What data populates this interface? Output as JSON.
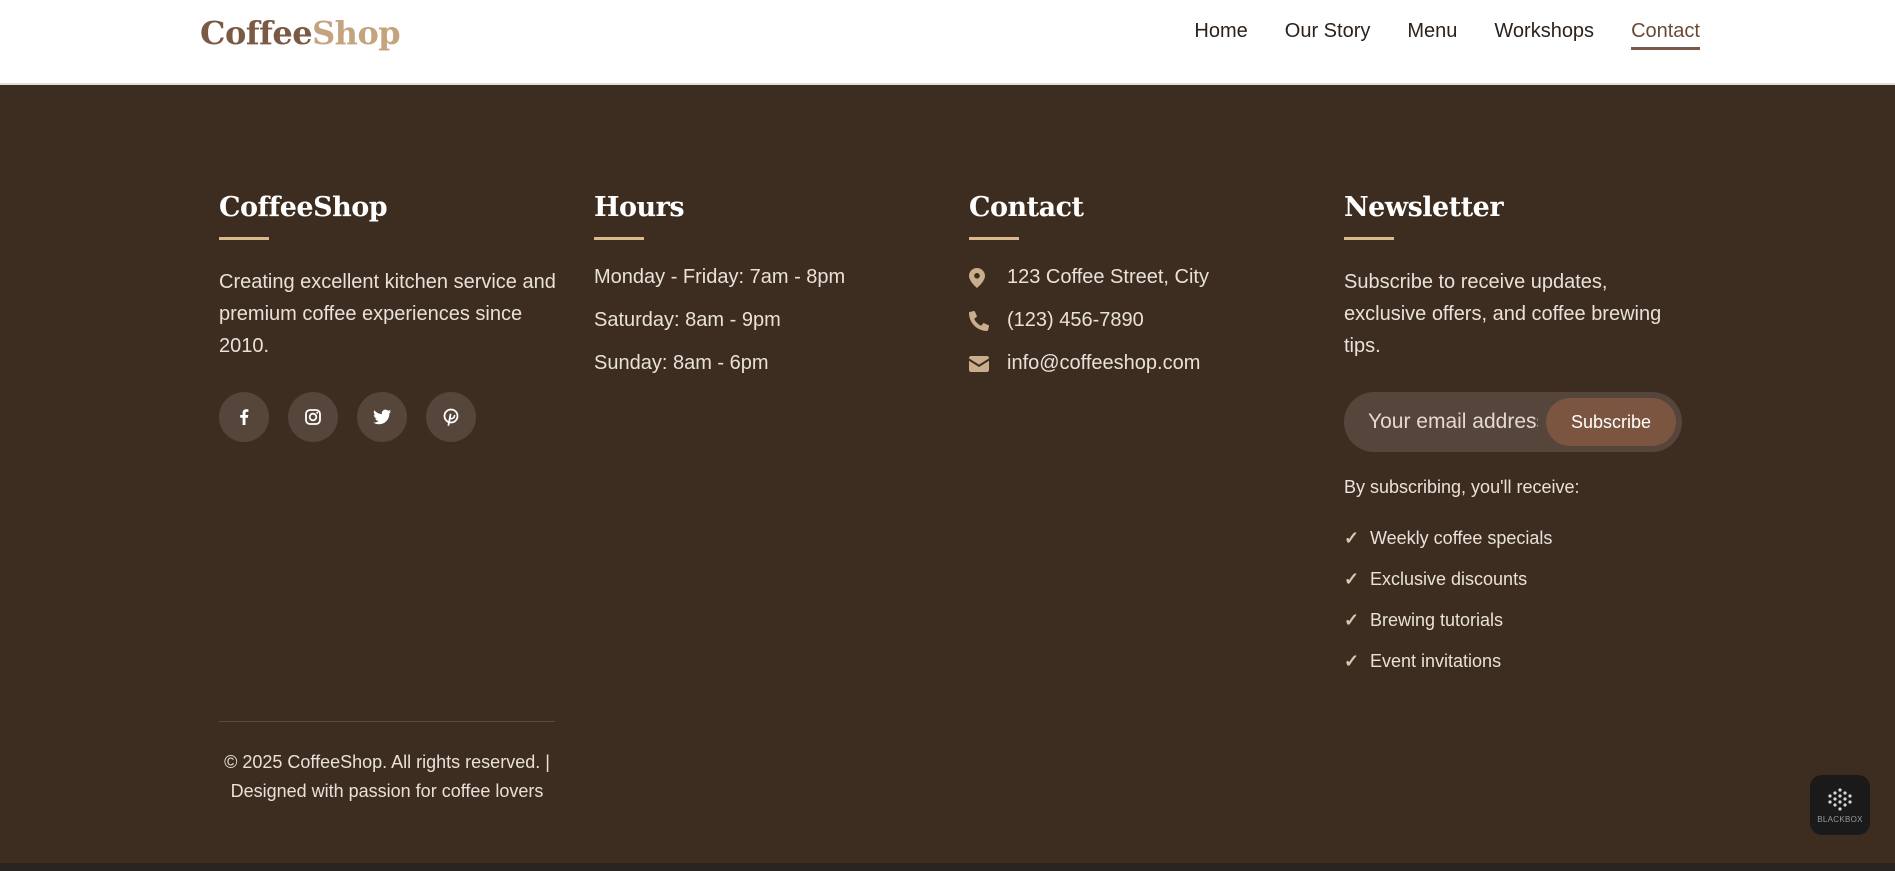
{
  "header": {
    "logo_part1": "Coffee",
    "logo_part2": "Shop",
    "nav": [
      {
        "label": "Home"
      },
      {
        "label": "Our Story"
      },
      {
        "label": "Menu"
      },
      {
        "label": "Workshops"
      },
      {
        "label": "Contact",
        "active": true
      }
    ]
  },
  "footer": {
    "about": {
      "title": "CoffeeShop",
      "text": "Creating excellent kitchen service and premium coffee experiences since 2010.",
      "social": [
        {
          "icon": "facebook-icon"
        },
        {
          "icon": "instagram-icon"
        },
        {
          "icon": "twitter-icon"
        },
        {
          "icon": "pinterest-icon"
        }
      ]
    },
    "hours": {
      "title": "Hours",
      "lines": [
        "Monday - Friday: 7am - 8pm",
        "Saturday: 8am - 9pm",
        "Sunday: 8am - 6pm"
      ]
    },
    "contact": {
      "title": "Contact",
      "address": "123 Coffee Street, City",
      "phone": "(123) 456-7890",
      "email": "info@coffeeshop.com"
    },
    "newsletter": {
      "title": "Newsletter",
      "text": "Subscribe to receive updates, exclusive offers, and coffee brewing tips.",
      "placeholder": "Your email address",
      "button": "Subscribe",
      "receive_label": "By subscribing, you'll receive:",
      "check": "✓",
      "benefits": [
        "Weekly coffee specials",
        "Exclusive discounts",
        "Brewing tutorials",
        "Event invitations"
      ]
    },
    "copyright_line1": "© 2025 CoffeeShop. All rights reserved. |",
    "copyright_line2": "Designed with passion for coffee lovers"
  },
  "badge": {
    "label": "BLACKBOX"
  },
  "colors": {
    "footer_bg": "#3d2d21",
    "accent": "#d9b98d",
    "brand_dark": "#7a5a45",
    "brand_light": "#c4a47f",
    "button": "#7b5540"
  }
}
